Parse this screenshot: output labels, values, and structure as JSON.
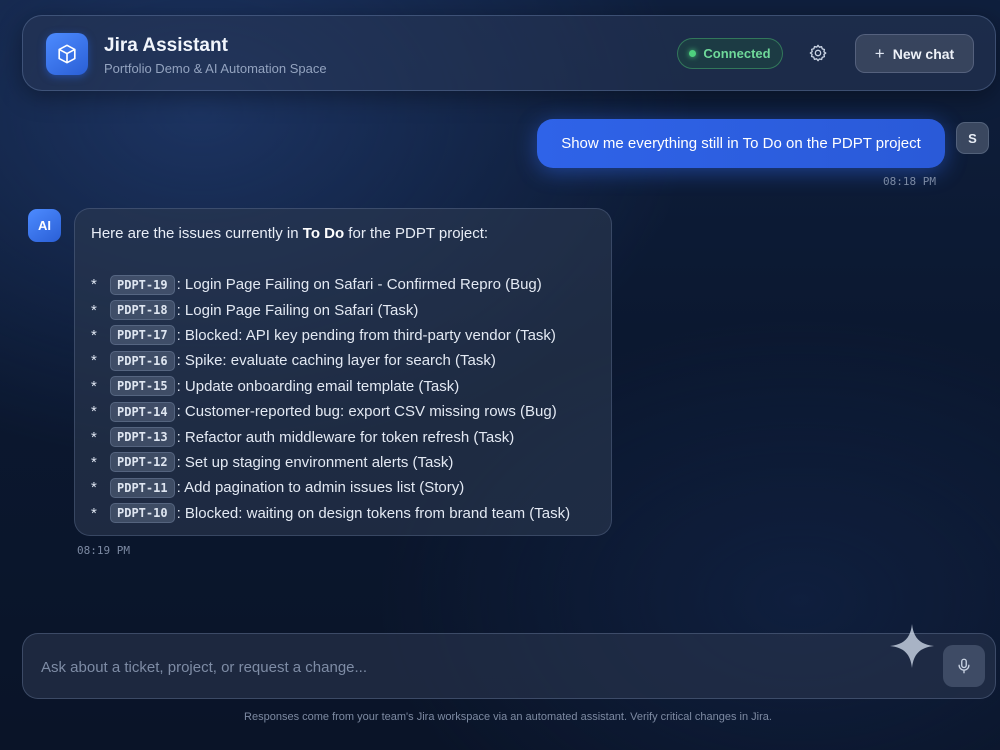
{
  "header": {
    "title": "Jira Assistant",
    "subtitle": "Portfolio Demo & AI Automation Space",
    "status": "Connected",
    "new_chat_label": "New chat",
    "logo_icon": "cube-icon",
    "settings_icon": "gear-icon"
  },
  "colors": {
    "accent": "#2f63e8",
    "status_green": "#4ed17e"
  },
  "messages": {
    "user": {
      "avatar": "S",
      "text": "Show me everything still in To Do on the PDPT project",
      "time": "08:18 PM"
    },
    "ai": {
      "avatar": "AI",
      "intro_prefix": "Here are the issues currently in ",
      "intro_bold": "To Do",
      "intro_suffix": " for the PDPT project:",
      "bullet": "*",
      "time": "08:19 PM",
      "issues": [
        {
          "key": "PDPT-19",
          "text": ": Login Page Failing on Safari - Confirmed Repro (Bug)"
        },
        {
          "key": "PDPT-18",
          "text": ": Login Page Failing on Safari (Task)"
        },
        {
          "key": "PDPT-17",
          "text": ": Blocked: API key pending from third-party vendor (Task)"
        },
        {
          "key": "PDPT-16",
          "text": ": Spike: evaluate caching layer for search (Task)"
        },
        {
          "key": "PDPT-15",
          "text": ": Update onboarding email template (Task)"
        },
        {
          "key": "PDPT-14",
          "text": ": Customer-reported bug: export CSV missing rows (Bug)"
        },
        {
          "key": "PDPT-13",
          "text": ": Refactor auth middleware for token refresh (Task)"
        },
        {
          "key": "PDPT-12",
          "text": ": Set up staging environment alerts (Task)"
        },
        {
          "key": "PDPT-11",
          "text": ": Add pagination to admin issues list (Story)"
        },
        {
          "key": "PDPT-10",
          "text": ": Blocked: waiting on design tokens from brand team (Task)"
        }
      ]
    }
  },
  "composer": {
    "placeholder": "Ask about a ticket, project, or request a change...",
    "value": "",
    "mic_icon": "microphone-icon",
    "sparkle_icon": "sparkle-icon"
  },
  "footer": {
    "note": "Responses come from your team's Jira workspace via an automated assistant. Verify critical changes in Jira."
  }
}
